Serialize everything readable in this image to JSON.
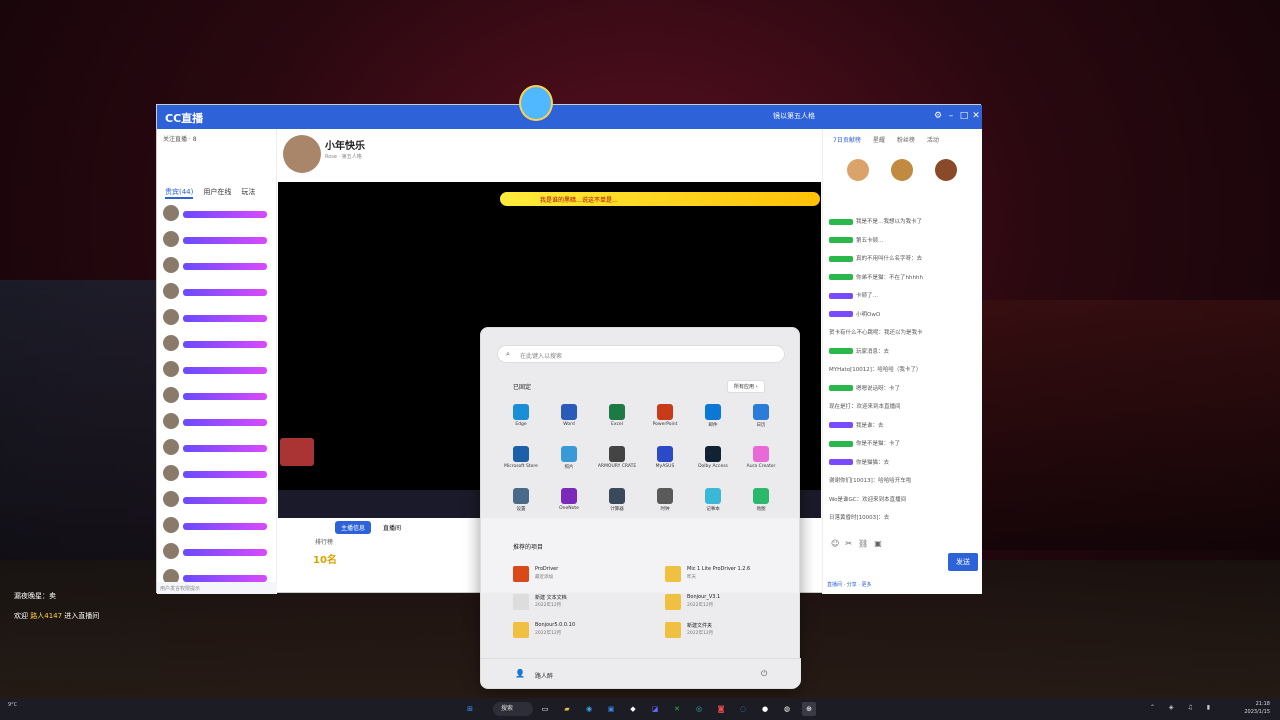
{
  "desktop": {
    "chat_lines": [
      {
        "prefix": "漏夜晚星：",
        "text": "卖"
      },
      {
        "prefix": "欢迎 ",
        "hl": "路人4147",
        "suffix": " 进入直播间"
      }
    ]
  },
  "cc": {
    "logo": "CC直播",
    "user_label": "镜以第五人格",
    "left_header": "关注直播 · 8",
    "left_tabs": [
      "贵宾(44)",
      "用户在线",
      "玩法"
    ],
    "left_footer": "用户发言权限提示",
    "anchor_name": "小年快乐",
    "anchor_meta": "Rose · 第五人格",
    "banner_text": "我是谁的黑暗…说这不单是…",
    "room_tabs": [
      "主播信息",
      "直播间"
    ],
    "rank_label": "排行榜",
    "rank_value": "10名",
    "right_tabs": [
      "7日贡献榜",
      "星耀",
      "粉丝榜",
      "活动"
    ],
    "chat_messages": [
      {
        "badge": "g",
        "text": "我是不是…我想以为我卡了"
      },
      {
        "badge": "g",
        "text": "第五卡顿…"
      },
      {
        "badge": "g",
        "text": "真的不用叫什么名字呀：去"
      },
      {
        "badge": "g",
        "text": "你弟不是猫：不在了hhhhh"
      },
      {
        "badge": "p",
        "text": "卡顿了…"
      },
      {
        "badge": "p",
        "text": "小明OwO"
      },
      {
        "badge": "",
        "text": "贺卡有什么不心跳呢：我还以为是我卡"
      },
      {
        "badge": "g",
        "text": "玩家消息：去"
      },
      {
        "badge": "",
        "text": "MYHato[10012]：哈哈哈（我卡了）"
      },
      {
        "badge": "g",
        "text": "嗯嗯说话呀：卡了"
      },
      {
        "badge": "",
        "text": "现在是打：欢迎来到本直播间"
      },
      {
        "badge": "p",
        "text": "我是谁：去"
      },
      {
        "badge": "g",
        "text": "你是不是猫：卡了"
      },
      {
        "badge": "p",
        "text": "你是猫猫：去"
      },
      {
        "badge": "",
        "text": "谢谢你们[10013]：哈哈哈开车啦"
      },
      {
        "badge": "",
        "text": "Wo是谁GC：欢迎来到本直播间"
      },
      {
        "badge": "",
        "text": "日落黄昏时[10003]：去"
      }
    ],
    "send_label": "发送",
    "right_footer": "直播间 · 分享 · 更多"
  },
  "start_menu": {
    "search_placeholder": "在此键入以搜索",
    "pinned_title": "已固定",
    "all_apps_label": "所有应用 ›",
    "apps": [
      {
        "label": "Edge",
        "icon": "edge-icon",
        "color": "#1a8fd8"
      },
      {
        "label": "Word",
        "icon": "word-icon",
        "color": "#2b5bb8"
      },
      {
        "label": "Excel",
        "icon": "excel-icon",
        "color": "#1d7a45"
      },
      {
        "label": "PowerPoint",
        "icon": "powerpoint-icon",
        "color": "#c83b1a"
      },
      {
        "label": "邮件",
        "icon": "mail-icon",
        "color": "#0a78d4"
      },
      {
        "label": "日历",
        "icon": "calendar-icon",
        "color": "#2b7bd8"
      },
      {
        "label": "Microsoft Store",
        "icon": "store-icon",
        "color": "#1d5fa8"
      },
      {
        "label": "照片",
        "icon": "photos-icon",
        "color": "#3a9ad8"
      },
      {
        "label": "ARMOURY CRATE",
        "icon": "armoury-icon",
        "color": "#444"
      },
      {
        "label": "MyASUS",
        "icon": "myasus-icon",
        "color": "#2a4ac8"
      },
      {
        "label": "Dolby Access",
        "icon": "dolby-icon",
        "color": "#123"
      },
      {
        "label": "Aura Creator",
        "icon": "aura-icon",
        "color": "#e86ad8"
      },
      {
        "label": "设置",
        "icon": "settings-icon",
        "color": "#4a6a8a"
      },
      {
        "label": "OneNote",
        "icon": "onenote-icon",
        "color": "#7a2ab8"
      },
      {
        "label": "计算器",
        "icon": "calculator-icon",
        "color": "#3a4a5a"
      },
      {
        "label": "时钟",
        "icon": "clock-icon",
        "color": "#5a5a5a"
      },
      {
        "label": "记事本",
        "icon": "notepad-icon",
        "color": "#3ab8d8"
      },
      {
        "label": "地图",
        "icon": "maps-icon",
        "color": "#2ab86a"
      }
    ],
    "recommended_title": "推荐的项目",
    "recommended": [
      {
        "t1": "ProDriver",
        "t2": "最近添加",
        "color": "#d84a1a"
      },
      {
        "t1": "Mic 1 Lite ProDriver 1.2.6",
        "t2": "昨天",
        "color": "#f0c040"
      },
      {
        "t1": "新建 文本文档",
        "t2": "2022年12月",
        "color": "#ddd"
      },
      {
        "t1": "Bonjour_V3.1",
        "t2": "2022年12月",
        "color": "#f0c040"
      },
      {
        "t1": "Bonjour5.0.0.10",
        "t2": "2022年12月",
        "color": "#f0c040"
      },
      {
        "t1": "新建文件夹",
        "t2": "2022年12月",
        "color": "#f0c040"
      }
    ],
    "user_name": "路人醉"
  },
  "taskbar": {
    "weather": "9°C",
    "search_label": "搜索",
    "time": "21:18",
    "date": "2023/1/15"
  }
}
